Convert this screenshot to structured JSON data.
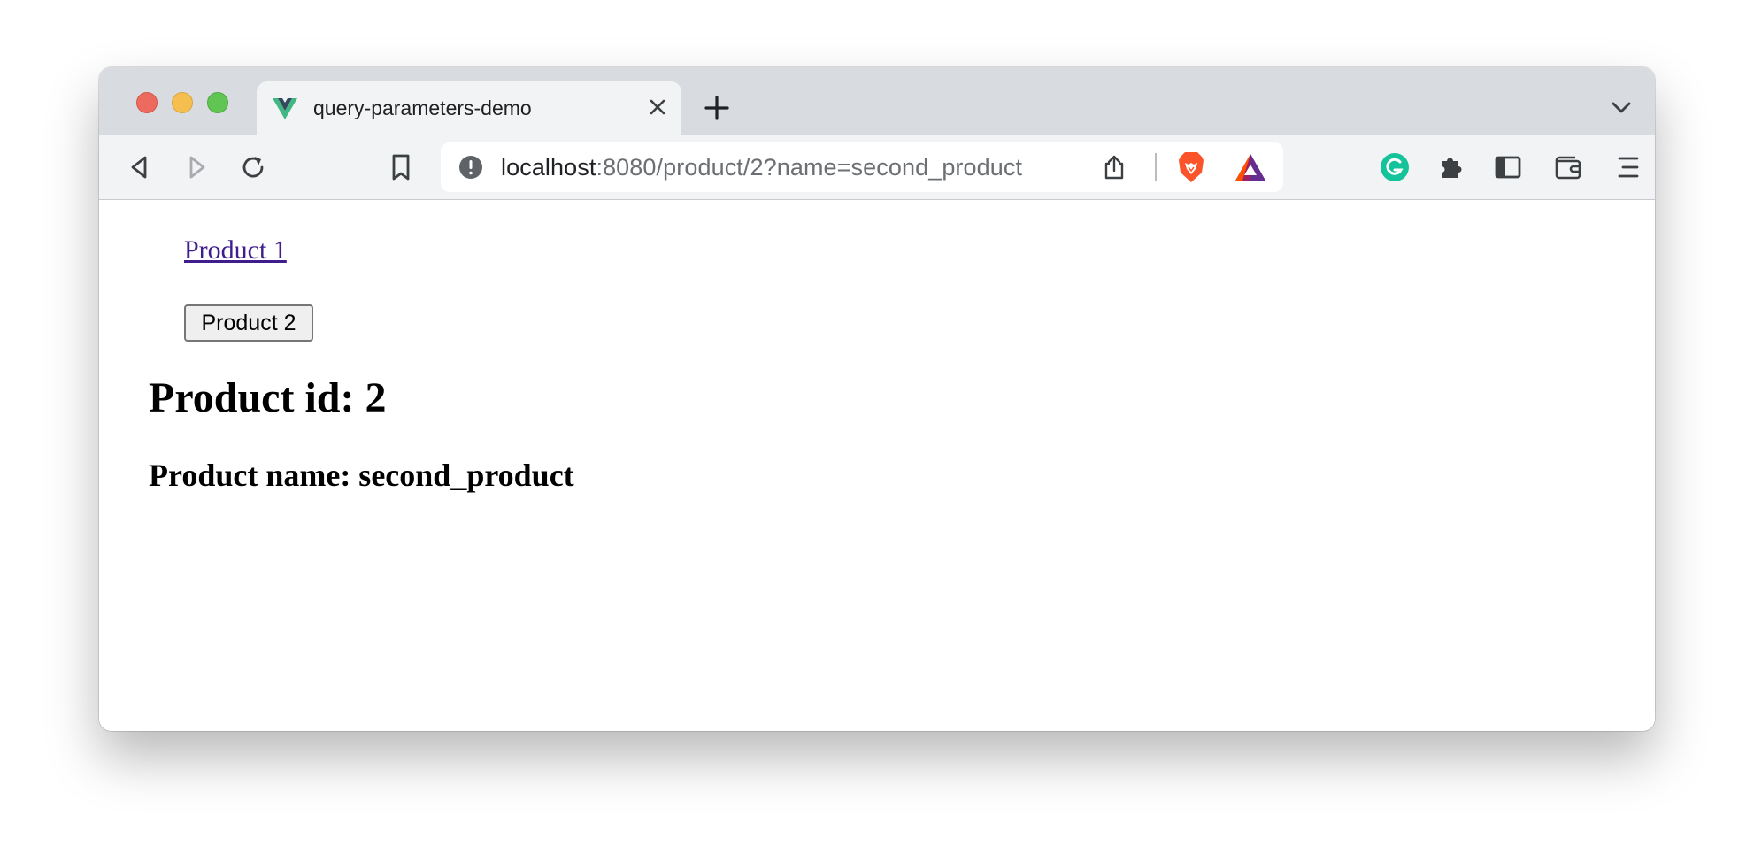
{
  "browser": {
    "tab": {
      "title": "query-parameters-demo",
      "favicon": "vue-logo-icon"
    },
    "address_bar": {
      "host": "localhost",
      "path": ":8080/product/2?name=second_product"
    },
    "colors": {
      "tabstrip_bg": "#d8dbdf",
      "toolbar_bg": "#f1f3f4",
      "close_red": "#ed6a5e",
      "minimize_yellow": "#f5bf4f",
      "zoom_green": "#61c554",
      "brave_orange": "#fb542b",
      "grammarly_green": "#15c39a"
    },
    "toolbar_icons": [
      "back-icon",
      "forward-icon",
      "reload-icon",
      "bookmark-icon",
      "site-info-icon",
      "share-icon",
      "brave-shields-icon",
      "brave-rewards-icon",
      "grammarly-icon",
      "extensions-icon",
      "sidebar-icon",
      "wallet-icon",
      "menu-icon"
    ]
  },
  "page": {
    "link_label": "Product 1",
    "button_label": "Product 2",
    "product_id_heading": "Product id: 2",
    "product_name_heading": "Product name: second_product",
    "link_color": "#3f1d8c"
  }
}
